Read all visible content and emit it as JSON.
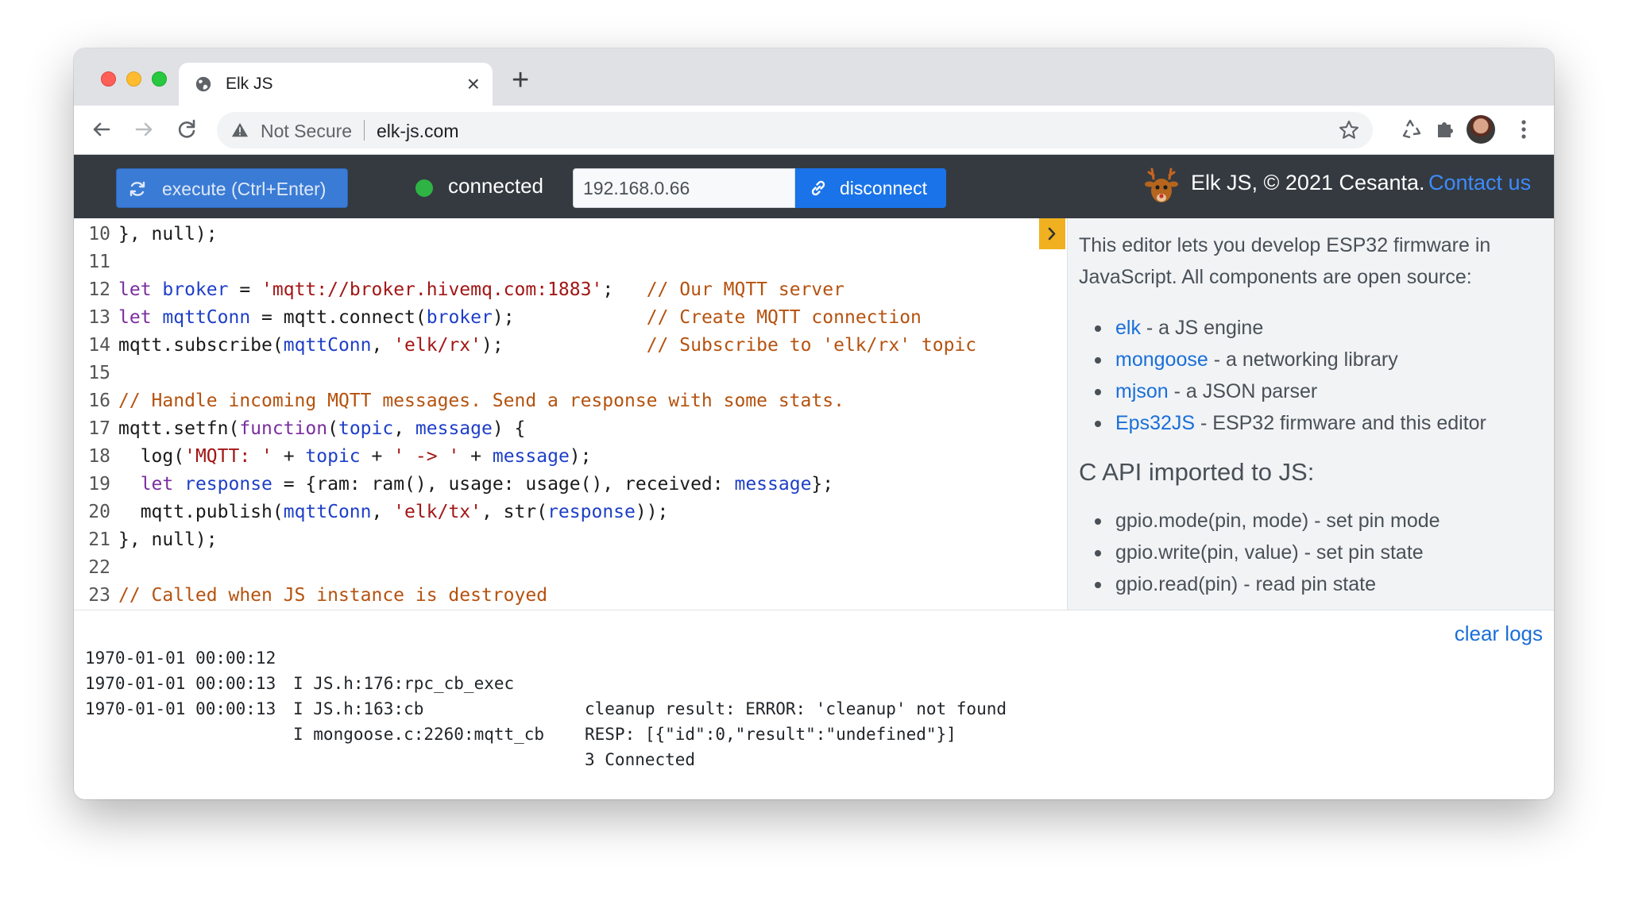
{
  "browser": {
    "tab_title": "Elk JS",
    "tab_close": "×",
    "new_tab": "+",
    "security_label": "Not Secure",
    "url": "elk-js.com"
  },
  "header": {
    "execute_label": "execute (Ctrl+Enter)",
    "status": "connected",
    "ip_address": "192.168.0.66",
    "disconnect_label": "disconnect",
    "brand": "Elk JS, © 2021 Cesanta.",
    "contact": "Contact us",
    "status_color": "#2fb344",
    "accent_color": "#1a73e8"
  },
  "editor": {
    "lines": [
      {
        "n": "10",
        "code": "}, null);"
      },
      {
        "n": "11",
        "code": ""
      },
      {
        "n": "12",
        "code": "let broker = 'mqtt://broker.hivemq.com:1883';   // Our MQTT server"
      },
      {
        "n": "13",
        "code": "let mqttConn = mqtt.connect(broker);            // Create MQTT connection"
      },
      {
        "n": "14",
        "code": "mqtt.subscribe(mqttConn, 'elk/rx');             // Subscribe to 'elk/rx' topic"
      },
      {
        "n": "15",
        "code": ""
      },
      {
        "n": "16",
        "code": "// Handle incoming MQTT messages. Send a response with some stats."
      },
      {
        "n": "17",
        "code": "mqtt.setfn(function(topic, message) {"
      },
      {
        "n": "18",
        "code": "  log('MQTT: ' + topic + ' -> ' + message);"
      },
      {
        "n": "19",
        "code": "  let response = {ram: ram(), usage: usage(), received: message};"
      },
      {
        "n": "20",
        "code": "  mqtt.publish(mqttConn, 'elk/tx', str(response));"
      },
      {
        "n": "21",
        "code": "}, null);"
      },
      {
        "n": "22",
        "code": ""
      },
      {
        "n": "23",
        "code": "// Called when JS instance is destroyed"
      }
    ]
  },
  "sidebar": {
    "intro": "This editor lets you develop ESP32 firmware in JavaScript. All components are open source:",
    "libraries": [
      {
        "name": "elk",
        "desc": " - a JS engine"
      },
      {
        "name": "mongoose",
        "desc": " - a networking library"
      },
      {
        "name": "mjson",
        "desc": " - a JSON parser"
      },
      {
        "name": "Eps32JS",
        "desc": " - ESP32 firmware and this editor"
      }
    ],
    "api_heading": "C API imported to JS:",
    "api": [
      "gpio.mode(pin, mode) - set pin mode",
      "gpio.write(pin, value) - set pin state",
      "gpio.read(pin) - read pin state"
    ]
  },
  "logs": {
    "clear_label": "clear logs",
    "rows": [
      {
        "ts": "1970-01-01 00:00:12",
        "src": "I JS.h:176:rpc_cb_exec",
        "msg": "cleanup result: ERROR: 'cleanup' not found"
      },
      {
        "ts": "1970-01-01 00:00:13",
        "src": "I JS.h:163:cb",
        "msg": "RESP: [{\"id\":0,\"result\":\"undefined\"}]"
      },
      {
        "ts": "1970-01-01 00:00:13",
        "src": "I mongoose.c:2260:mqtt_cb",
        "msg": "3 Connected"
      }
    ]
  }
}
